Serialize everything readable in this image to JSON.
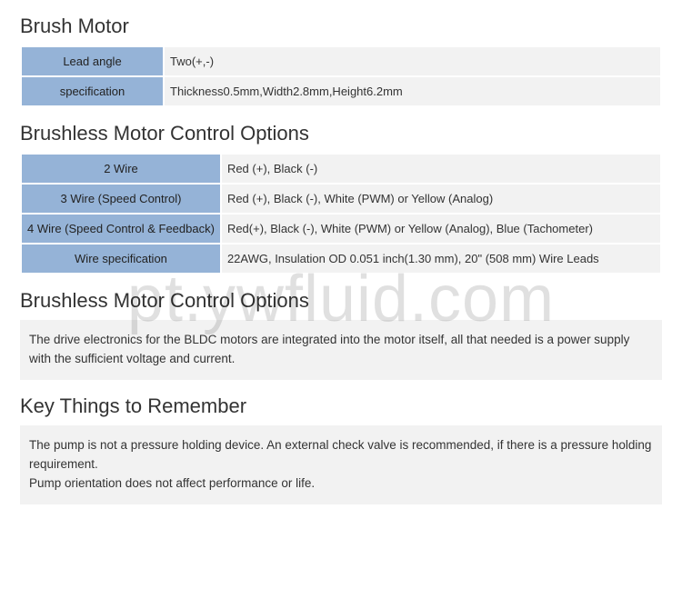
{
  "section1": {
    "title": "Brush Motor",
    "rows": [
      {
        "label": "Lead angle",
        "value": "Two(+,-)"
      },
      {
        "label": "specification",
        "value": "Thickness0.5mm,Width2.8mm,Height6.2mm"
      }
    ]
  },
  "section2": {
    "title": "Brushless Motor Control Options",
    "rows": [
      {
        "label": "2 Wire",
        "value": "Red (+), Black (-)"
      },
      {
        "label": "3 Wire (Speed Control)",
        "value": "Red (+), Black (-), White (PWM) or Yellow (Analog)"
      },
      {
        "label": "4 Wire (Speed Control & Feedback)",
        "value": "Red(+), Black (-), White (PWM) or Yellow (Analog), Blue (Tachometer)"
      },
      {
        "label": "Wire specification",
        "value": "22AWG, Insulation OD 0.051 inch(1.30 mm), 20\" (508 mm) Wire Leads"
      }
    ]
  },
  "section3": {
    "title": "Brushless Motor Control Options",
    "note": "The drive electronics for the BLDC motors are integrated into the motor itself, all that needed is a power supply with the sufficient voltage and current."
  },
  "section4": {
    "title": "Key Things to Remember",
    "note_line1": "The pump is not a pressure holding device. An external check valve is recommended, if there is a pressure holding requirement.",
    "note_line2": "Pump orientation does not affect performance or life."
  },
  "watermark": "pt.ywfluid.com"
}
